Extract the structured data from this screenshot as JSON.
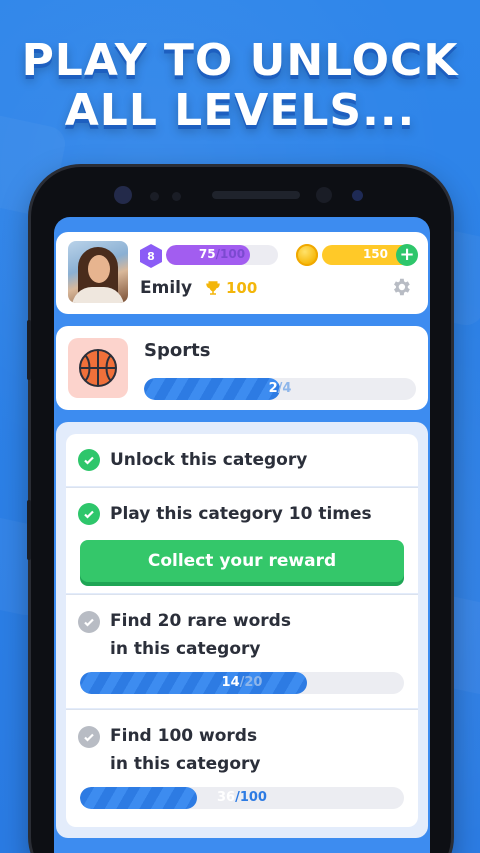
{
  "headline": {
    "line1": "PLAY TO UNLOCK",
    "line2": "ALL LEVELS..."
  },
  "profile": {
    "level": "8",
    "xp_current": "75",
    "xp_total": "/100",
    "xp_progress": 0.75,
    "coins": "150",
    "name": "Emily",
    "trophies": "100"
  },
  "category": {
    "name": "Sports",
    "progress_current": "2",
    "progress_total": "/4",
    "progress": 0.5
  },
  "tasks": [
    {
      "text": "Unlock this category",
      "done": true
    },
    {
      "text": "Play this category 10 times",
      "done": true,
      "button": "Collect your reward"
    },
    {
      "text_line1": "Find 20 rare words",
      "text_line2": "in this category",
      "done": false,
      "current": "14",
      "total": "/20",
      "progress": 0.7
    },
    {
      "text_line1": "Find 100 words",
      "text_line2": "in this category",
      "done": false,
      "current": "36",
      "total": "/100",
      "progress": 0.36
    }
  ],
  "colors": {
    "background": "#2a7fe6",
    "accent_green": "#2ec66b",
    "accent_purple": "#a25df0",
    "accent_gold": "#ffc928",
    "bar_blue": "#2d7be3"
  },
  "icons": [
    "check-icon",
    "coin-icon",
    "trophy-icon",
    "gear-icon",
    "basketball-icon",
    "plus-icon"
  ]
}
